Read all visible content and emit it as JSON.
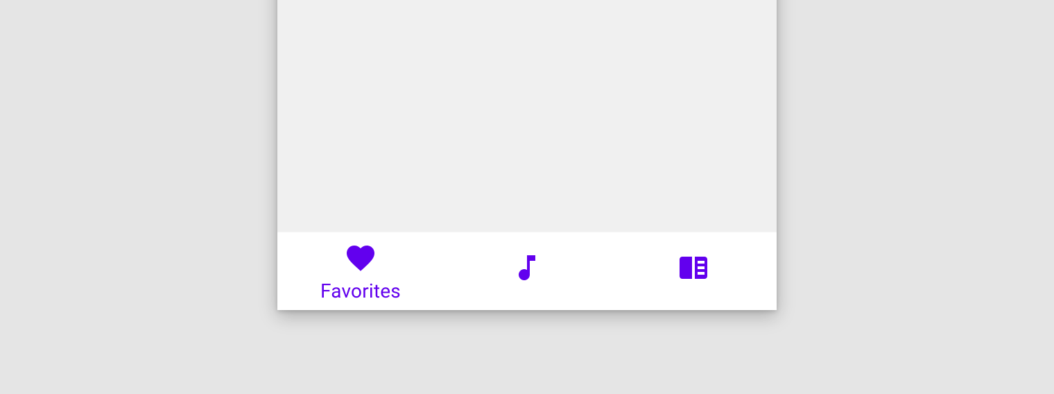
{
  "colors": {
    "primary": "#6200ee",
    "page_bg": "#e5e5e5",
    "content_bg": "#f0f0f0",
    "nav_bg": "#ffffff"
  },
  "bottom_nav": {
    "items": [
      {
        "icon": "heart-icon",
        "label": "Favorites",
        "active": true
      },
      {
        "icon": "music-note-icon",
        "label": "",
        "active": false
      },
      {
        "icon": "book-icon",
        "label": "",
        "active": false
      }
    ]
  }
}
